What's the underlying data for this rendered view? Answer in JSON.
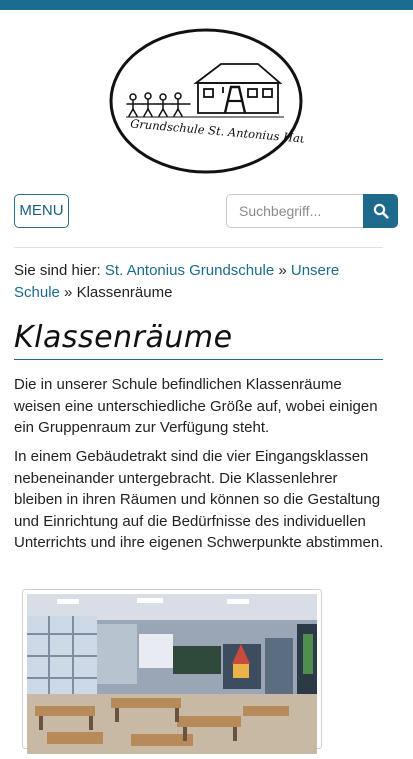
{
  "logo": {
    "caption": "Grundschule St. Antonius Hau"
  },
  "header": {
    "menu_label": "MENU"
  },
  "search": {
    "placeholder": "Suchbegriff..."
  },
  "breadcrumb": {
    "prefix": "Sie sind hier:",
    "items": [
      "St. Antonius Grundschule",
      "Unsere Schule",
      "Klassenräume"
    ],
    "separator": "»"
  },
  "page": {
    "title": "Klassenräume",
    "paragraphs": [
      "Die in unserer Schule befindlichen Klassenräume weisen eine unterschiedliche Größe auf, wobei einigen ein Gruppenraum zur Verfügung steht.",
      "In einem Gebäudetrakt sind die vier Eingangsklassen nebeneinander untergebracht. Die Klassenlehrer bleiben in ihren Räumen und können so die Gestaltung und Einrichtung auf die Bedürfnisse des individuellen Unterrichts und ihre eigenen Schwerpunkte abstimmen."
    ]
  },
  "colors": {
    "accent": "#1e6a8c",
    "link": "#1d6a8a",
    "topbar": "#1a6c8f"
  },
  "icons": {
    "search_button": "search-icon"
  }
}
